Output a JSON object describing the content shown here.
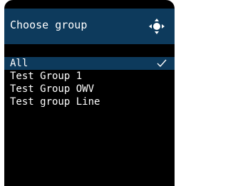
{
  "header": {
    "title": "Choose group",
    "nav_icon": "dpad-navigation-icon"
  },
  "groups": [
    {
      "label": "All",
      "selected": true
    },
    {
      "label": "Test Group 1",
      "selected": false
    },
    {
      "label": "Test Group OWV",
      "selected": false
    },
    {
      "label": "Test group Line",
      "selected": false
    }
  ],
  "colors": {
    "background": "#000000",
    "header_bg": "#0d3a5c",
    "selected_bg": "#0d3a5c",
    "text": "#ffffff"
  }
}
